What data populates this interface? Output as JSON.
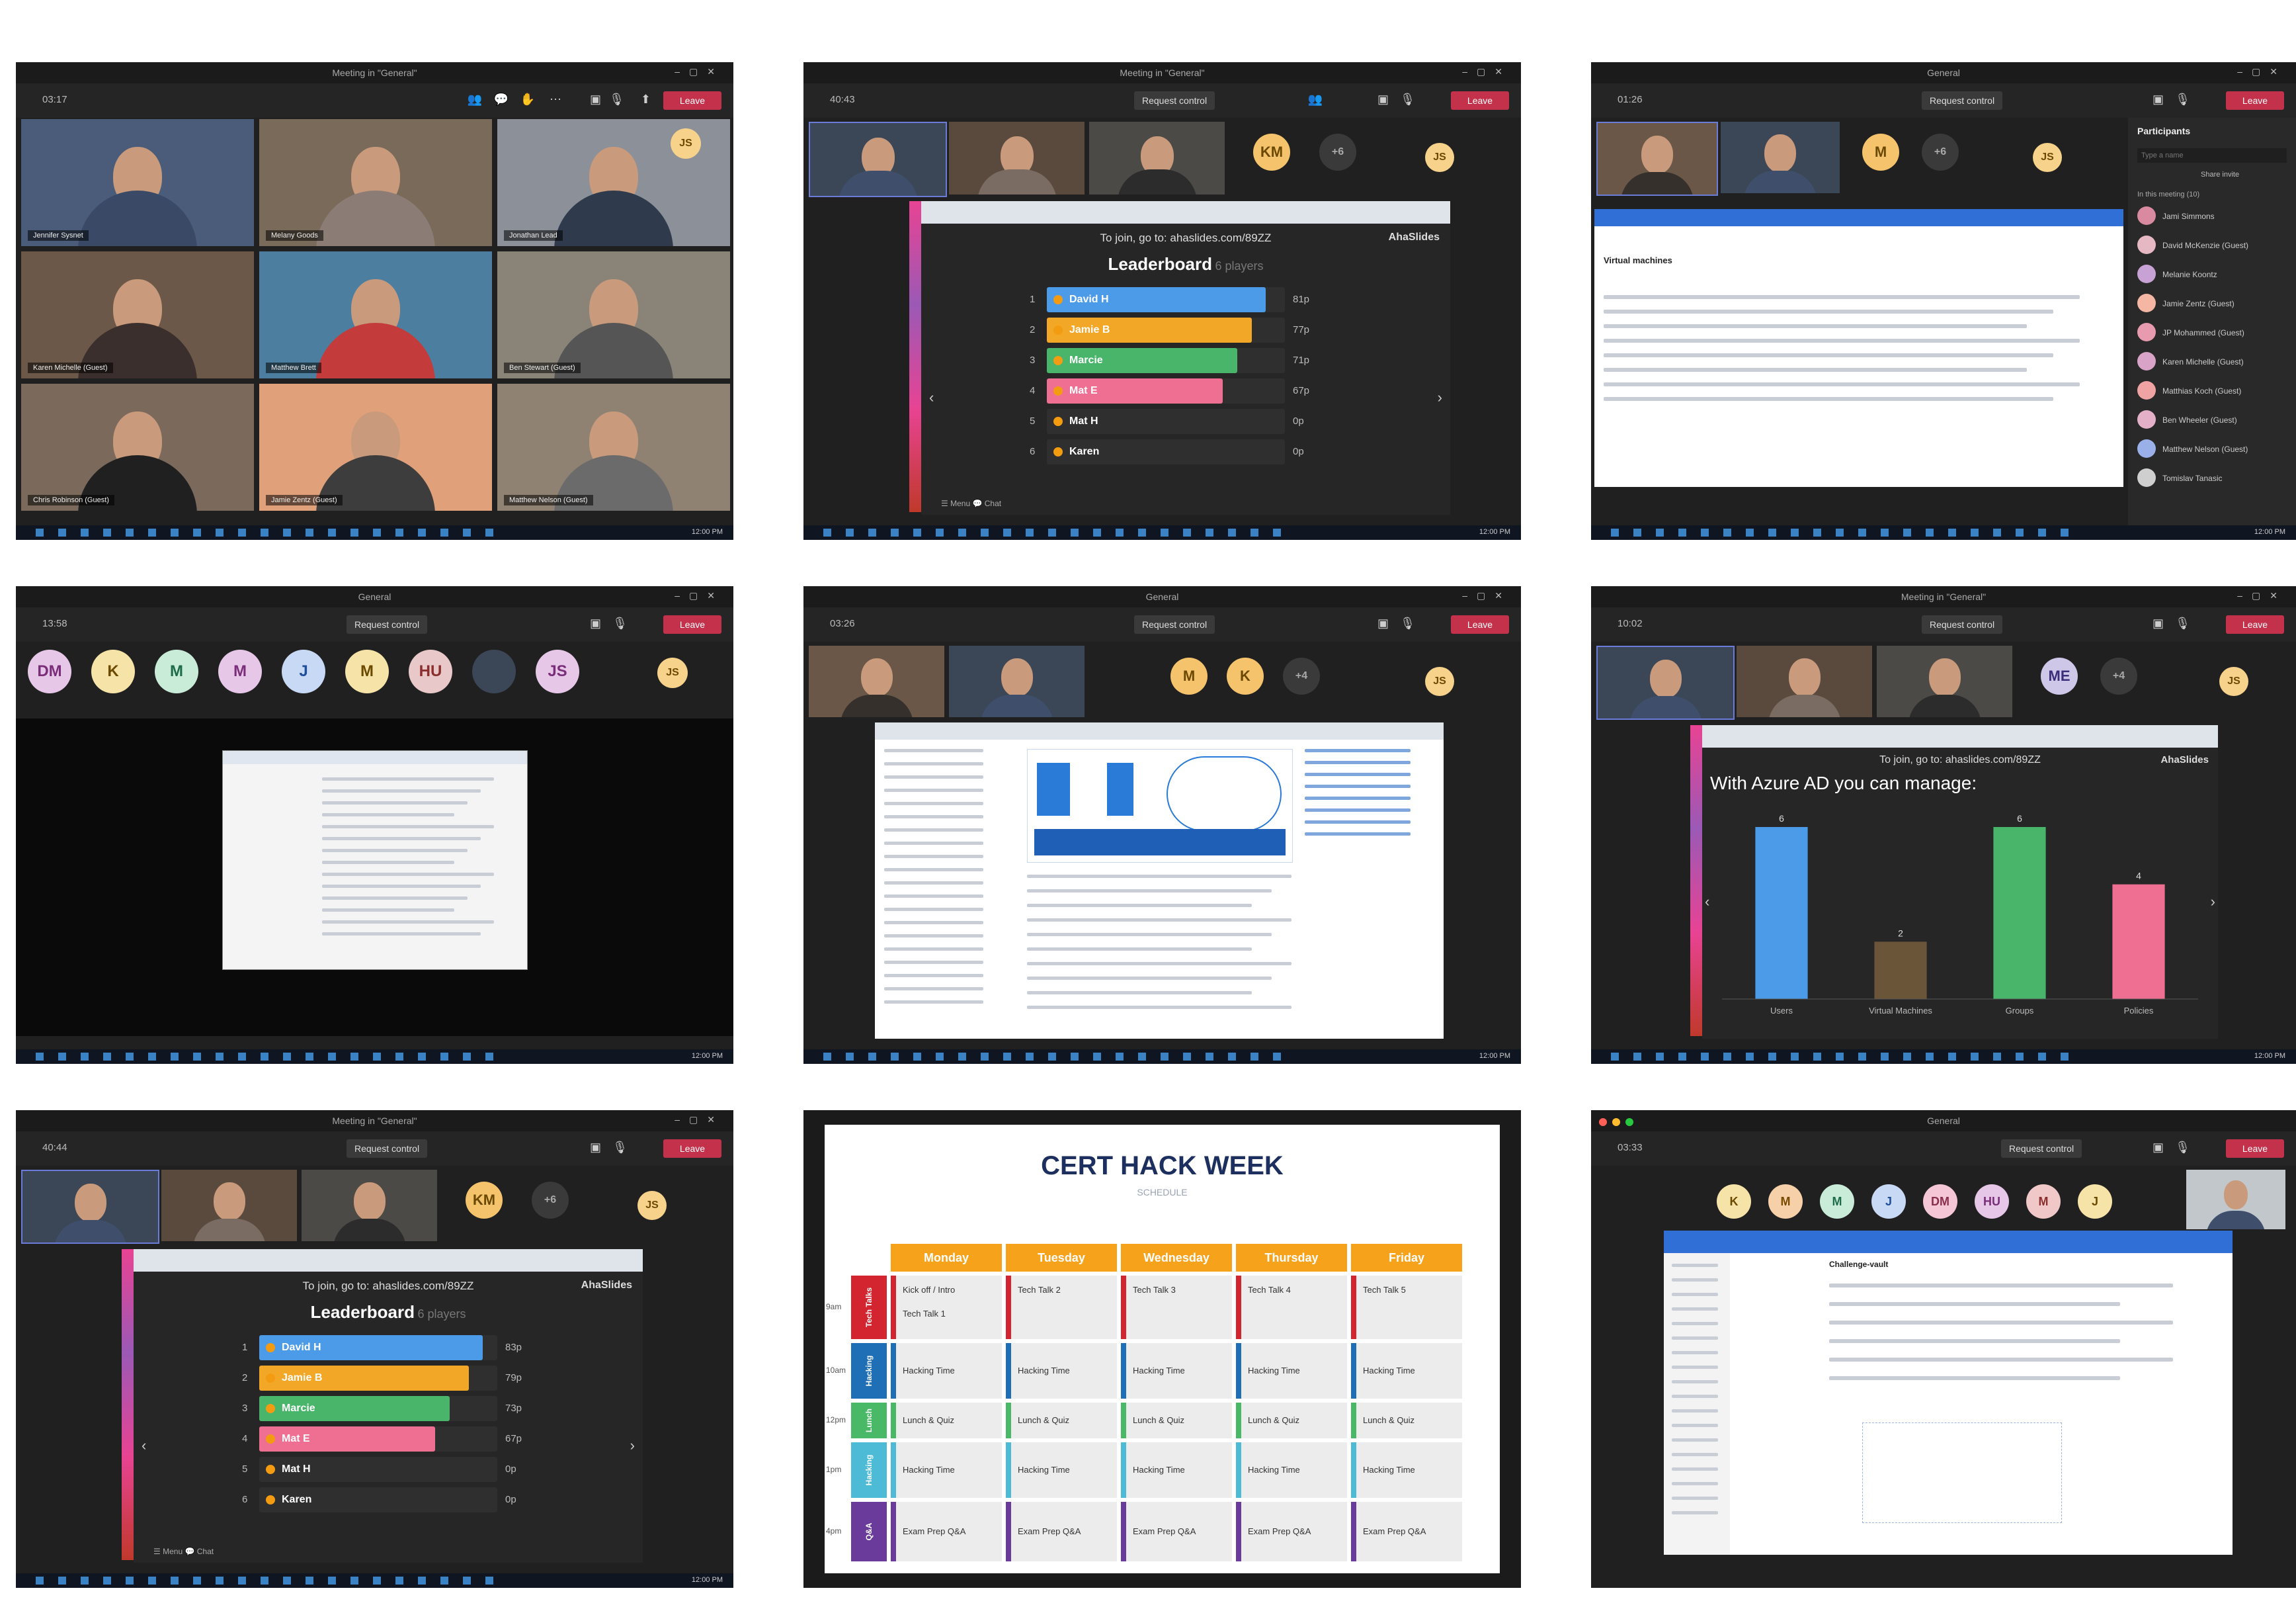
{
  "colors": {
    "teams_dark": "#202020",
    "leave_red": "#c4314b",
    "bar_blue": "#4c9be8",
    "bar_yellow": "#f2a727",
    "bar_green": "#48b56a",
    "bar_pink": "#ee6f92",
    "bar_brown": "#6b5538",
    "schedule_orange": "#f7a21b",
    "schedule_red": "#d32530",
    "schedule_blue": "#1f6fb6",
    "schedule_green": "#49b968",
    "schedule_cyan": "#4dbbd6",
    "schedule_purple": "#6a3b9a"
  },
  "common": {
    "request_control": "Request control",
    "leave_label": "Leave",
    "clock": "12:00 PM",
    "join_text": "To join, go to: ahaslides.com/89ZZ",
    "brand": "AhaSlides",
    "chat_label": "Chat",
    "menu_label": "Menu"
  },
  "tiles": [
    {
      "title": "Meeting in \"General\"",
      "timer": "03:17",
      "participants": [
        {
          "name": "Jennifer Sysnet"
        },
        {
          "name": "Melany Goods"
        },
        {
          "name": "Jonathan Lead"
        },
        {
          "name": "Karen Michelle (Guest)"
        },
        {
          "name": "Matthew Brett"
        },
        {
          "name": "Ben Stewart (Guest)"
        },
        {
          "name": "Chris Robinson (Guest)"
        },
        {
          "name": "Jamie Zentz (Guest)"
        },
        {
          "name": "Matthew Nelson (Guest)"
        }
      ],
      "self_avatar": "JS"
    },
    {
      "title": "Meeting in \"General\"",
      "timer": "40:43",
      "avatars": [
        "KM",
        "+6",
        "JS"
      ],
      "leaderboard_title": "Leaderboard",
      "leaderboard_sub": "6 players",
      "leaderboard": [
        {
          "rank": "1",
          "name": "David H",
          "score": "81p",
          "fill": 0.92
        },
        {
          "rank": "2",
          "name": "Jamie B",
          "score": "77p",
          "fill": 0.86
        },
        {
          "rank": "3",
          "name": "Marcie",
          "score": "71p",
          "fill": 0.8
        },
        {
          "rank": "4",
          "name": "Mat E",
          "score": "67p",
          "fill": 0.74
        },
        {
          "rank": "5",
          "name": "Mat H",
          "score": "0p",
          "fill": 0.0
        },
        {
          "rank": "6",
          "name": "Karen",
          "score": "0p",
          "fill": 0.0
        }
      ]
    },
    {
      "title": "General",
      "timer": "01:26",
      "avatars": [
        "M",
        "+6",
        "JS"
      ],
      "panel_title": "Participants",
      "panel_search": "Type a name",
      "share_invite": "Share invite",
      "section": "In this meeting (10)",
      "participants": [
        {
          "name": "Jami Simmons"
        },
        {
          "name": "David McKenzie (Guest)"
        },
        {
          "name": "Melanie Koontz"
        },
        {
          "name": "Jamie Zentz (Guest)"
        },
        {
          "name": "JP Mohammed (Guest)"
        },
        {
          "name": "Karen Michelle (Guest)"
        },
        {
          "name": "Matthias Koch (Guest)"
        },
        {
          "name": "Ben Wheeler (Guest)"
        },
        {
          "name": "Matthew Nelson (Guest)"
        },
        {
          "name": "Tomislav Tanasic"
        }
      ],
      "portal_title": "Virtual machines"
    },
    {
      "title": "General",
      "timer": "13:58",
      "avatars": [
        "DM",
        "K",
        "M",
        "M",
        "J",
        "M",
        "HU",
        "",
        "JS",
        "JS"
      ]
    },
    {
      "title": "General",
      "timer": "03:26",
      "avatars": [
        "M",
        "K",
        "+4",
        "JS"
      ]
    },
    {
      "title": "Meeting in \"General\"",
      "timer": "10:02",
      "avatars": [
        "ME",
        "+4",
        "JS"
      ],
      "chart_heading": "With Azure AD you can manage:"
    },
    {
      "title": "Meeting in \"General\"",
      "timer": "40:44",
      "avatars": [
        "KM",
        "+6",
        "JS"
      ],
      "leaderboard_title": "Leaderboard",
      "leaderboard_sub": "6 players",
      "leaderboard": [
        {
          "rank": "1",
          "name": "David H",
          "score": "83p",
          "fill": 0.94
        },
        {
          "rank": "2",
          "name": "Jamie B",
          "score": "79p",
          "fill": 0.88
        },
        {
          "rank": "3",
          "name": "Marcie",
          "score": "73p",
          "fill": 0.8
        },
        {
          "rank": "4",
          "name": "Mat E",
          "score": "67p",
          "fill": 0.74
        },
        {
          "rank": "5",
          "name": "Mat H",
          "score": "0p",
          "fill": 0.0
        },
        {
          "rank": "6",
          "name": "Karen",
          "score": "0p",
          "fill": 0.0
        }
      ]
    },
    {
      "schedule_title": "CERT HACK WEEK",
      "schedule_sub": "SCHEDULE",
      "days": [
        "Monday",
        "Tuesday",
        "Wednesday",
        "Thursday",
        "Friday"
      ],
      "row_labels": [
        "Tech Talks",
        "Hacking",
        "Lunch",
        "Hacking",
        "Q&A"
      ],
      "times": [
        "9am",
        "10am",
        "12pm",
        "1pm",
        "4pm"
      ],
      "rows": [
        [
          "Kick off / Intro",
          "Tech Talk 2",
          "Tech Talk 3",
          "Tech Talk 4",
          "Tech Talk 5"
        ],
        [
          "Hacking Time",
          "Hacking Time",
          "Hacking Time",
          "Hacking Time",
          "Hacking Time"
        ],
        [
          "Lunch & Quiz",
          "Lunch & Quiz",
          "Lunch & Quiz",
          "Lunch & Quiz",
          "Lunch & Quiz"
        ],
        [
          "Hacking Time",
          "Hacking Time",
          "Hacking Time",
          "Hacking Time",
          "Hacking Time"
        ],
        [
          "Exam Prep Q&A",
          "Exam Prep Q&A",
          "Exam Prep Q&A",
          "Exam Prep Q&A",
          "Exam Prep Q&A"
        ]
      ],
      "row_extra": "Tech Talk 1"
    },
    {
      "title": "General",
      "timer": "03:33",
      "avatars": [
        "K",
        "M",
        "M",
        "J",
        "DM",
        "HU",
        "M",
        "J"
      ],
      "portal_title": "Challenge-vault"
    }
  ],
  "chart_data": {
    "type": "bar",
    "title": "With Azure AD you can manage:",
    "categories": [
      "Users",
      "Virtual Machines",
      "Groups",
      "Policies"
    ],
    "values": [
      6,
      2,
      6,
      4
    ],
    "ylim": [
      0,
      6
    ],
    "colors": [
      "#4c9be8",
      "#6b5538",
      "#48b56a",
      "#ee6f92"
    ],
    "grid": false
  }
}
